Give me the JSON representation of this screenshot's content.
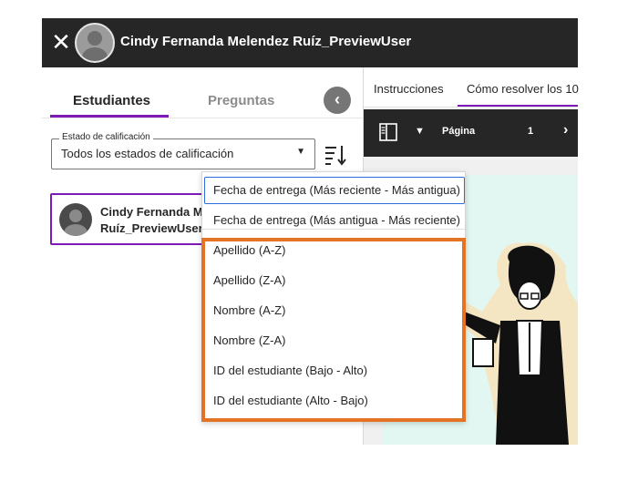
{
  "header": {
    "close_icon": "close-icon",
    "user_name": "Cindy Fernanda Melendez Ruíz_PreviewUser"
  },
  "left_panel": {
    "tabs": [
      {
        "label": "Estudiantes",
        "active": true
      },
      {
        "label": "Preguntas",
        "active": false
      }
    ],
    "back_icon": "chevron-left-icon",
    "filter": {
      "legend": "Estado de calificación",
      "value": "Todos los estados de calificación"
    },
    "sort_icon": "sort-icon",
    "student": {
      "name_line1": "Cindy Fernanda Me",
      "name_line2": "Ruíz_PreviewUser"
    }
  },
  "right_panel": {
    "tabs": [
      {
        "label": "Instrucciones",
        "active": false
      },
      {
        "label": "Cómo resolver los 10",
        "active": true
      }
    ],
    "toolbar": {
      "page_label": "Página",
      "page_number": "1"
    }
  },
  "sort_menu": {
    "items": [
      {
        "label": "Fecha de entrega (Más reciente - Más antigua)",
        "selected": true
      },
      {
        "label": "Fecha de entrega (Más antigua - Más reciente)",
        "selected": false
      },
      {
        "label": "Apellido (A-Z)",
        "selected": false
      },
      {
        "label": "Apellido (Z-A)",
        "selected": false
      },
      {
        "label": "Nombre (A-Z)",
        "selected": false
      },
      {
        "label": "Nombre (Z-A)",
        "selected": false
      },
      {
        "label": "ID del estudiante (Bajo - Alto)",
        "selected": false
      },
      {
        "label": "ID del estudiante (Alto - Bajo)",
        "selected": false
      }
    ]
  },
  "colors": {
    "accent_purple": "#7e1ab5",
    "highlight_orange": "#e47424",
    "topbar": "#262626",
    "focus_blue": "#2d6cdf"
  }
}
